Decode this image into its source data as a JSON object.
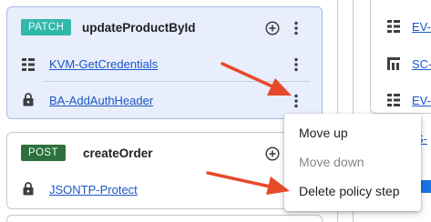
{
  "flows": [
    {
      "method": "PATCH",
      "name": "updateProductById",
      "steps": [
        {
          "label": "KVM-GetCredentials",
          "icon": "kvm-grid-icon"
        },
        {
          "label": "BA-AddAuthHeader",
          "icon": "lock-icon"
        }
      ]
    },
    {
      "method": "POST",
      "name": "createOrder",
      "steps": [
        {
          "label": "JSONTP-Protect",
          "icon": "lock-icon"
        }
      ]
    }
  ],
  "right_panel": {
    "items": [
      {
        "label": "EV-",
        "icon": "kvm-grid-icon"
      },
      {
        "label": "SC-",
        "icon": "stat-collector-icon"
      },
      {
        "label": "EV-",
        "icon": "kvm-grid-icon"
      },
      {
        "label": "S-",
        "icon": ""
      }
    ]
  },
  "context_menu": {
    "items": [
      {
        "label": "Move up",
        "enabled": true
      },
      {
        "label": "Move down",
        "enabled": false
      },
      {
        "label": "Delete policy step",
        "enabled": true
      }
    ]
  },
  "colors": {
    "selected_card": "#e8eefb",
    "patch_badge": "#31b8a9",
    "post_badge": "#2d6f3d",
    "link": "#1a56c9",
    "annotation_arrow": "#e8492a"
  }
}
